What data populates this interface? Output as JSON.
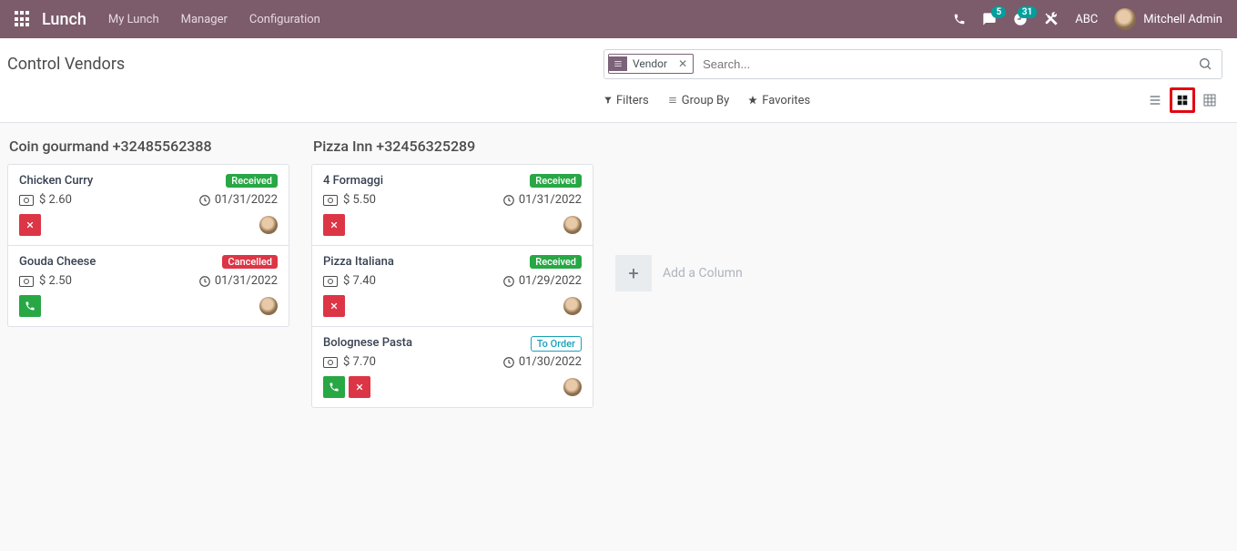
{
  "navbar": {
    "brand": "Lunch",
    "links": [
      "My Lunch",
      "Manager",
      "Configuration"
    ],
    "msg_count": "5",
    "activity_count": "31",
    "company": "ABC",
    "user": "Mitchell Admin"
  },
  "header": {
    "title": "Control Vendors",
    "search_facet": "Vendor",
    "search_placeholder": "Search...",
    "filters_label": "Filters",
    "groupby_label": "Group By",
    "favorites_label": "Favorites"
  },
  "columns": [
    {
      "title": "Coin gourmand +32485562388",
      "cards": [
        {
          "name": "Chicken Curry",
          "price": "2.60",
          "date": "01/31/2022",
          "status": "Received",
          "status_class": "pill-received",
          "actions": [
            "cancel"
          ]
        },
        {
          "name": "Gouda Cheese",
          "price": "2.50",
          "date": "01/31/2022",
          "status": "Cancelled",
          "status_class": "pill-cancelled",
          "actions": [
            "call"
          ]
        }
      ]
    },
    {
      "title": "Pizza Inn +32456325289",
      "cards": [
        {
          "name": "4 Formaggi",
          "price": "5.50",
          "date": "01/31/2022",
          "status": "Received",
          "status_class": "pill-received",
          "actions": [
            "cancel"
          ]
        },
        {
          "name": "Pizza Italiana",
          "price": "7.40",
          "date": "01/29/2022",
          "status": "Received",
          "status_class": "pill-received",
          "actions": [
            "cancel"
          ]
        },
        {
          "name": "Bolognese Pasta",
          "price": "7.70",
          "date": "01/30/2022",
          "status": "To Order",
          "status_class": "pill-toorder",
          "actions": [
            "call",
            "cancel"
          ]
        }
      ]
    }
  ],
  "add_column_label": "Add a Column",
  "currency": "$"
}
